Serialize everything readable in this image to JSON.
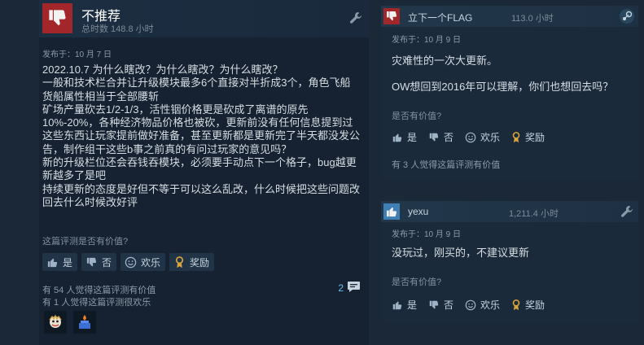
{
  "review": {
    "recommendation": "不推荐",
    "hours": "总时数 148.8 小时",
    "posted": "发布于：10 月 7 日",
    "body_lines": [
      "2022.10.7 为什么瞎改？为什么瞎改？为什么瞎改？",
      "一般和技术栏合并让升级模块最多6个直接对半折成3个，角色飞船",
      "货船属性相当于全部腰斩",
      "矿场产量砍去1/2-1/3，活性铟价格更是砍成了离谱的原先",
      "10%-20%，各种经济物品价格也被砍，更新前没有任何信息提到过",
      "这些东西让玩家提前做好准备，甚至更新都是更新完了半天都没发公",
      "告，制作组干这些b事之前真的有问过玩家的意见吗？",
      "新的升级栏位还会吞钱吞模块，必须要手动点下一个格子，bug越更",
      "新越多了是吧",
      "持续更新的态度是好但不等于可以这么乱改，什么时候把这些问题改",
      "回去什么时候改好评"
    ],
    "helpful_question": "这篇评测是否有价值?",
    "votes": {
      "yes": "是",
      "no": "否",
      "funny": "欢乐",
      "award": "奖励"
    },
    "helpful_count": "有 54 人觉得这篇评测有价值",
    "funny_count": "有 1 人觉得这篇评测很欢乐",
    "comments_count": "2"
  },
  "comments": [
    {
      "name": "立下一个FLAG",
      "hours": "113.0 小时",
      "posted": "发布于：10 月 9 日",
      "lines": [
        "灾难性的一次大更新。",
        "OW想回到2016年可以理解，你们也想回去吗？"
      ],
      "helpful_question": "是否有价值?",
      "votes": {
        "yes": "是",
        "no": "否",
        "funny": "欢乐",
        "award": "奖励"
      },
      "stat": "有 3 人觉得这篇评测有价值"
    },
    {
      "name": "yexu",
      "hours": "1,211.4 小时",
      "posted": "发布于：10 月 9 日",
      "lines": [
        "没玩过，刚买的，不建议更新"
      ],
      "helpful_question": "是否有价值?",
      "votes": {
        "yes": "是",
        "no": "否",
        "funny": "欢乐",
        "award": "奖励"
      },
      "stat": ""
    }
  ],
  "colors": {
    "thumb_down": "#a3272a",
    "thumb_up": "#3f7fb3",
    "accent": "#66c0f4",
    "award": "#d8a53a"
  }
}
